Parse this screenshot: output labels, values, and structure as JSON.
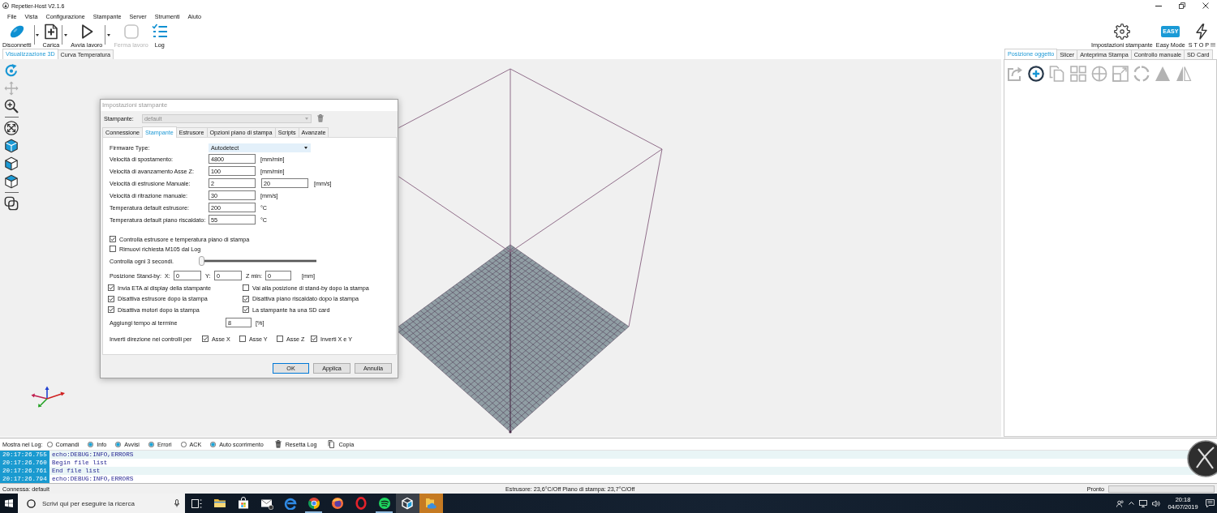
{
  "window": {
    "title": "Repetier-Host V2.1.6"
  },
  "menu": [
    "File",
    "Vista",
    "Configurazione",
    "Stampante",
    "Server",
    "Strumenti",
    "Aiuto"
  ],
  "toolbar": [
    {
      "label": "Disconnetti",
      "dropdown": true,
      "disabled": false
    },
    {
      "label": "Carica",
      "dropdown": true,
      "disabled": false
    },
    {
      "label": "Avvia lavoro",
      "dropdown": true,
      "disabled": false
    },
    {
      "label": "Ferma lavoro",
      "dropdown": false,
      "disabled": true
    },
    {
      "label": "Log",
      "dropdown": false,
      "disabled": false
    }
  ],
  "toolbar_right": {
    "settings": {
      "label": "Impostazioni stampante"
    },
    "easy_mode": {
      "label": "Easy Mode",
      "badge": "EASY"
    },
    "stop": {
      "label": "S T O P !!!"
    }
  },
  "view_tabs": [
    {
      "label": "Visualizzazione 3D",
      "selected": true
    },
    {
      "label": "Curva Temperatura",
      "selected": false
    }
  ],
  "view_tools": [
    {
      "selected": true,
      "disabled": false
    },
    {
      "selected": false,
      "disabled": true
    },
    {
      "selected": false,
      "disabled": false
    },
    {
      "selected": false,
      "disabled": false
    },
    {
      "selected": false,
      "disabled": false
    },
    {
      "selected": false,
      "disabled": false
    },
    {
      "selected": false,
      "disabled": false
    },
    {
      "selected": false,
      "disabled": false
    }
  ],
  "panel_tabs": [
    {
      "label": "Posizione oggetto",
      "selected": true
    },
    {
      "label": "Slicer",
      "selected": false
    },
    {
      "label": "Anteprima Stampa",
      "selected": false
    },
    {
      "label": "Controllo manuale",
      "selected": false
    },
    {
      "label": "SD Card",
      "selected": false
    }
  ],
  "object_tools": [
    {
      "disabled": true
    },
    {
      "disabled": false
    },
    {
      "disabled": true
    },
    {
      "disabled": true
    },
    {
      "disabled": true
    },
    {
      "disabled": true
    },
    {
      "disabled": true
    },
    {
      "disabled": true
    },
    {
      "disabled": true
    }
  ],
  "dialog": {
    "title": "Impostazioni stampante",
    "printer": {
      "label": "Stampante:",
      "value": "default",
      "disabled": true
    },
    "tabs": [
      {
        "label": "Connessione",
        "selected": false
      },
      {
        "label": "Stampante",
        "selected": true
      },
      {
        "label": "Estrusore",
        "selected": false
      },
      {
        "label": "Opzioni piano di stampa",
        "selected": false
      },
      {
        "label": "Scripts",
        "selected": false
      },
      {
        "label": "Avanzate",
        "selected": false
      }
    ],
    "firmware": {
      "label": "Firmware Type:",
      "value": "Autodetect"
    },
    "fields": [
      {
        "label": "Velocità di spostamento:",
        "values": [
          "4800"
        ],
        "unit": "[mm/min]"
      },
      {
        "label": "Velocità di avanzamento Asse Z:",
        "values": [
          "100"
        ],
        "unit": "[mm/min]"
      },
      {
        "label": "Velocità di estrusione Manuale:",
        "values": [
          "2",
          "20"
        ],
        "unit": "[mm/s]"
      },
      {
        "label": "Velocità di ritrazione manuale:",
        "values": [
          "30"
        ],
        "unit": "[mm/s]"
      },
      {
        "label": "Temperatura default estrusore:",
        "values": [
          "200"
        ],
        "unit": "°C"
      },
      {
        "label": "Temperatura default piano riscaldato:",
        "values": [
          "55"
        ],
        "unit": "°C"
      }
    ],
    "options": [
      {
        "label": "Controlla estrusore e temperatura piano di stampa",
        "checked": true
      },
      {
        "label": "Rimuovi richiesta M105 dal Log",
        "checked": false
      }
    ],
    "interval": {
      "label": "Controlla ogni 3 secondi.",
      "level": 0
    },
    "standby": {
      "label": "Posizione Stand-by:",
      "coords": [
        {
          "label": "X:",
          "value": "0"
        },
        {
          "label": "Y:",
          "value": "0"
        },
        {
          "label": "Z min:",
          "value": "0"
        }
      ],
      "unit": "[mm]"
    },
    "after_print": [
      {
        "label": "Invia ETA al display della stampante",
        "checked": true
      },
      {
        "label": "Vai alla posizione di stand-by dopo la stampa",
        "checked": false
      },
      {
        "label": "Disattiva estrusore dopo la stampa",
        "checked": true
      },
      {
        "label": "Disattiva piano riscaldato dopo la stampa",
        "checked": true
      },
      {
        "label": "Disattiva motori dopo la stampa",
        "checked": true
      },
      {
        "label": "La stampante ha una SD card",
        "checked": true
      }
    ],
    "add_time": {
      "label": "Aggiungi tempo al termine",
      "value": "8",
      "unit": "[%]"
    },
    "invert": {
      "label": "Inverti direzione nei controlli per",
      "axes": [
        {
          "label": "Asse X",
          "checked": true
        },
        {
          "label": "Asse Y",
          "checked": false
        },
        {
          "label": "Asse Z",
          "checked": false
        },
        {
          "label": "Inverti X e Y",
          "checked": true
        }
      ]
    },
    "buttons": [
      {
        "label": "OK",
        "default": true
      },
      {
        "label": "Applica",
        "default": false
      },
      {
        "label": "Annulla",
        "default": false
      }
    ]
  },
  "log": {
    "filter_label": "Mostra nel Log:",
    "filters": [
      {
        "label": "Comandi",
        "checked": false
      },
      {
        "label": "Info",
        "checked": true
      },
      {
        "label": "Avvisi",
        "checked": true
      },
      {
        "label": "Errori",
        "checked": true
      },
      {
        "label": "ACK",
        "checked": false
      },
      {
        "label": "Auto scorrimento",
        "checked": true
      }
    ],
    "actions": [
      {
        "label": "Resetta Log"
      },
      {
        "label": "Copia"
      }
    ],
    "lines": [
      {
        "time": "20:17:26.755",
        "text": "echo:DEBUG:INFO,ERRORS"
      },
      {
        "time": "20:17:26.760",
        "text": "Begin file list"
      },
      {
        "time": "20:17:26.761",
        "text": "End file list"
      },
      {
        "time": "20:17:26.794",
        "text": "echo:DEBUG:INFO,ERRORS"
      }
    ]
  },
  "status_bar": {
    "connection": "Connessa: default",
    "temperatures": "Estrusore: 23,6°C/Off Piano di stampa: 23,7°C/Off",
    "state": "Pronto",
    "progress": {
      "level": 0
    }
  },
  "taskbar": {
    "search": {
      "placeholder": "Scrivi qui per eseguire la ricerca"
    },
    "apps": [
      {
        "running": false,
        "selected": false,
        "flashing": false
      },
      {
        "running": false,
        "selected": false,
        "flashing": false
      },
      {
        "running": false,
        "selected": false,
        "flashing": false
      },
      {
        "running": false,
        "selected": false,
        "flashing": false
      },
      {
        "running": true,
        "selected": false,
        "flashing": false
      },
      {
        "running": false,
        "selected": false,
        "flashing": false
      },
      {
        "running": false,
        "selected": false,
        "flashing": false
      },
      {
        "running": true,
        "selected": false,
        "flashing": false
      },
      {
        "running": false,
        "selected": true,
        "flashing": false
      },
      {
        "running": false,
        "selected": false,
        "flashing": true
      }
    ],
    "clock": {
      "time": "20:18",
      "date": "04/07/2019"
    }
  }
}
